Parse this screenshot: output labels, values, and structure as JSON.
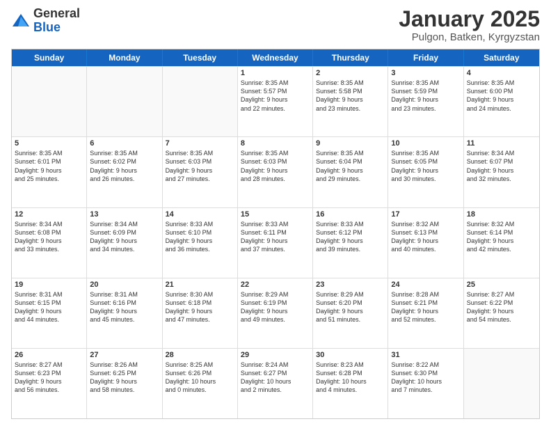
{
  "logo": {
    "general": "General",
    "blue": "Blue"
  },
  "title": {
    "month": "January 2025",
    "location": "Pulgon, Batken, Kyrgyzstan"
  },
  "weekdays": [
    "Sunday",
    "Monday",
    "Tuesday",
    "Wednesday",
    "Thursday",
    "Friday",
    "Saturday"
  ],
  "weeks": [
    [
      {
        "day": null,
        "info": null
      },
      {
        "day": null,
        "info": null
      },
      {
        "day": null,
        "info": null
      },
      {
        "day": "1",
        "info": "Sunrise: 8:35 AM\nSunset: 5:57 PM\nDaylight: 9 hours\nand 22 minutes."
      },
      {
        "day": "2",
        "info": "Sunrise: 8:35 AM\nSunset: 5:58 PM\nDaylight: 9 hours\nand 23 minutes."
      },
      {
        "day": "3",
        "info": "Sunrise: 8:35 AM\nSunset: 5:59 PM\nDaylight: 9 hours\nand 23 minutes."
      },
      {
        "day": "4",
        "info": "Sunrise: 8:35 AM\nSunset: 6:00 PM\nDaylight: 9 hours\nand 24 minutes."
      }
    ],
    [
      {
        "day": "5",
        "info": "Sunrise: 8:35 AM\nSunset: 6:01 PM\nDaylight: 9 hours\nand 25 minutes."
      },
      {
        "day": "6",
        "info": "Sunrise: 8:35 AM\nSunset: 6:02 PM\nDaylight: 9 hours\nand 26 minutes."
      },
      {
        "day": "7",
        "info": "Sunrise: 8:35 AM\nSunset: 6:03 PM\nDaylight: 9 hours\nand 27 minutes."
      },
      {
        "day": "8",
        "info": "Sunrise: 8:35 AM\nSunset: 6:03 PM\nDaylight: 9 hours\nand 28 minutes."
      },
      {
        "day": "9",
        "info": "Sunrise: 8:35 AM\nSunset: 6:04 PM\nDaylight: 9 hours\nand 29 minutes."
      },
      {
        "day": "10",
        "info": "Sunrise: 8:35 AM\nSunset: 6:05 PM\nDaylight: 9 hours\nand 30 minutes."
      },
      {
        "day": "11",
        "info": "Sunrise: 8:34 AM\nSunset: 6:07 PM\nDaylight: 9 hours\nand 32 minutes."
      }
    ],
    [
      {
        "day": "12",
        "info": "Sunrise: 8:34 AM\nSunset: 6:08 PM\nDaylight: 9 hours\nand 33 minutes."
      },
      {
        "day": "13",
        "info": "Sunrise: 8:34 AM\nSunset: 6:09 PM\nDaylight: 9 hours\nand 34 minutes."
      },
      {
        "day": "14",
        "info": "Sunrise: 8:33 AM\nSunset: 6:10 PM\nDaylight: 9 hours\nand 36 minutes."
      },
      {
        "day": "15",
        "info": "Sunrise: 8:33 AM\nSunset: 6:11 PM\nDaylight: 9 hours\nand 37 minutes."
      },
      {
        "day": "16",
        "info": "Sunrise: 8:33 AM\nSunset: 6:12 PM\nDaylight: 9 hours\nand 39 minutes."
      },
      {
        "day": "17",
        "info": "Sunrise: 8:32 AM\nSunset: 6:13 PM\nDaylight: 9 hours\nand 40 minutes."
      },
      {
        "day": "18",
        "info": "Sunrise: 8:32 AM\nSunset: 6:14 PM\nDaylight: 9 hours\nand 42 minutes."
      }
    ],
    [
      {
        "day": "19",
        "info": "Sunrise: 8:31 AM\nSunset: 6:15 PM\nDaylight: 9 hours\nand 44 minutes."
      },
      {
        "day": "20",
        "info": "Sunrise: 8:31 AM\nSunset: 6:16 PM\nDaylight: 9 hours\nand 45 minutes."
      },
      {
        "day": "21",
        "info": "Sunrise: 8:30 AM\nSunset: 6:18 PM\nDaylight: 9 hours\nand 47 minutes."
      },
      {
        "day": "22",
        "info": "Sunrise: 8:29 AM\nSunset: 6:19 PM\nDaylight: 9 hours\nand 49 minutes."
      },
      {
        "day": "23",
        "info": "Sunrise: 8:29 AM\nSunset: 6:20 PM\nDaylight: 9 hours\nand 51 minutes."
      },
      {
        "day": "24",
        "info": "Sunrise: 8:28 AM\nSunset: 6:21 PM\nDaylight: 9 hours\nand 52 minutes."
      },
      {
        "day": "25",
        "info": "Sunrise: 8:27 AM\nSunset: 6:22 PM\nDaylight: 9 hours\nand 54 minutes."
      }
    ],
    [
      {
        "day": "26",
        "info": "Sunrise: 8:27 AM\nSunset: 6:23 PM\nDaylight: 9 hours\nand 56 minutes."
      },
      {
        "day": "27",
        "info": "Sunrise: 8:26 AM\nSunset: 6:25 PM\nDaylight: 9 hours\nand 58 minutes."
      },
      {
        "day": "28",
        "info": "Sunrise: 8:25 AM\nSunset: 6:26 PM\nDaylight: 10 hours\nand 0 minutes."
      },
      {
        "day": "29",
        "info": "Sunrise: 8:24 AM\nSunset: 6:27 PM\nDaylight: 10 hours\nand 2 minutes."
      },
      {
        "day": "30",
        "info": "Sunrise: 8:23 AM\nSunset: 6:28 PM\nDaylight: 10 hours\nand 4 minutes."
      },
      {
        "day": "31",
        "info": "Sunrise: 8:22 AM\nSunset: 6:30 PM\nDaylight: 10 hours\nand 7 minutes."
      },
      {
        "day": null,
        "info": null
      }
    ]
  ]
}
